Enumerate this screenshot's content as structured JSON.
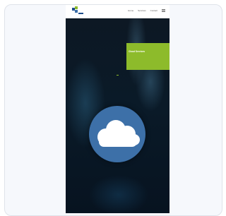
{
  "page": {
    "background": "#f6f8fc",
    "border": "#dfe3ea"
  },
  "header": {
    "logo": "company-logo",
    "nav": [
      {
        "label": "Home"
      },
      {
        "label": "Services"
      },
      {
        "label": "Contact"
      }
    ],
    "menu_icon": "hamburger-icon"
  },
  "hero": {
    "banner_title": "Cloud Services",
    "banner_color": "#8dbb2b",
    "badge_icon": "cloud-icon",
    "badge_color": "#3d70a8"
  }
}
